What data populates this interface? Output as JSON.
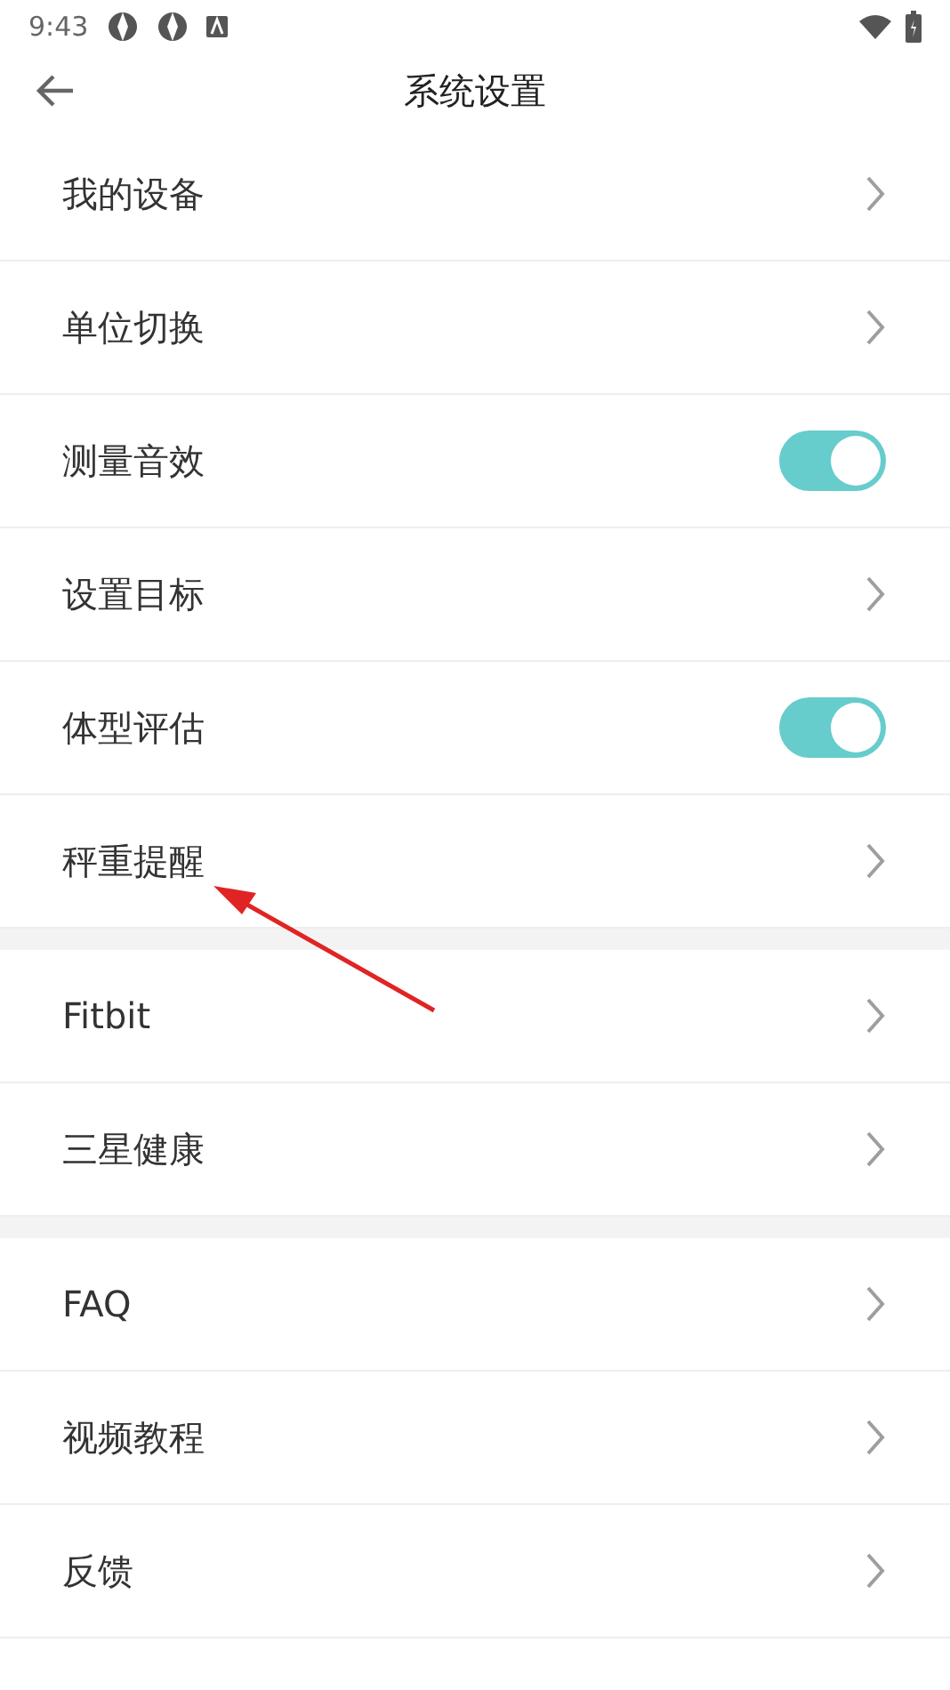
{
  "status_bar": {
    "time": "9:43"
  },
  "header": {
    "title": "系统设置"
  },
  "groups": [
    {
      "items": [
        {
          "label": "我的设备",
          "kind": "link"
        },
        {
          "label": "单位切换",
          "kind": "link"
        },
        {
          "label": "测量音效",
          "kind": "toggle",
          "on": true
        },
        {
          "label": "设置目标",
          "kind": "link"
        },
        {
          "label": "体型评估",
          "kind": "toggle",
          "on": true
        },
        {
          "label": "秤重提醒",
          "kind": "link"
        }
      ]
    },
    {
      "items": [
        {
          "label": "Fitbit",
          "kind": "link"
        },
        {
          "label": "三星健康",
          "kind": "link"
        }
      ]
    },
    {
      "items": [
        {
          "label": "FAQ",
          "kind": "link"
        },
        {
          "label": "视频教程",
          "kind": "link"
        },
        {
          "label": "反馈",
          "kind": "link"
        }
      ]
    }
  ]
}
